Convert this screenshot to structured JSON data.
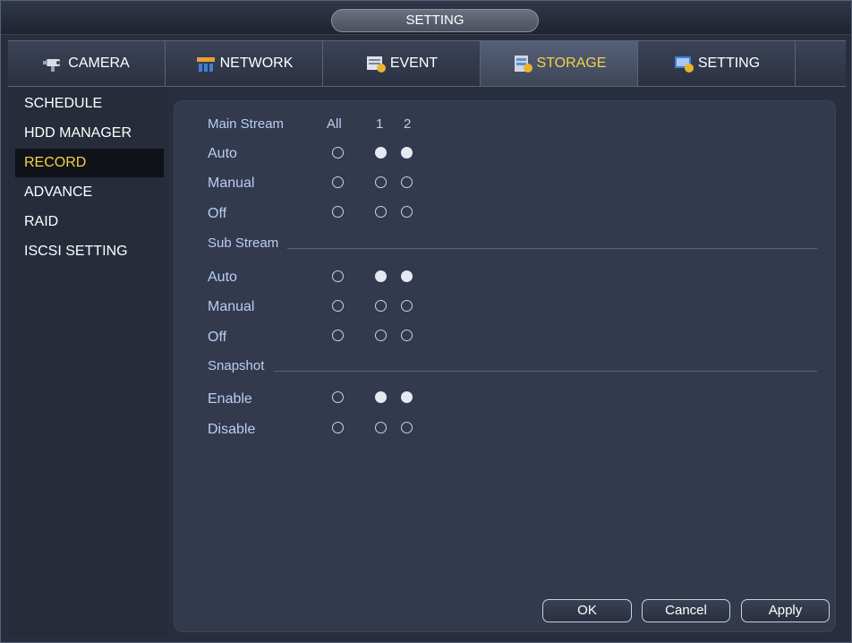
{
  "window": {
    "title": "SETTING"
  },
  "tabs": [
    {
      "label": "CAMERA",
      "icon": "camera-icon"
    },
    {
      "label": "NETWORK",
      "icon": "network-icon"
    },
    {
      "label": "EVENT",
      "icon": "event-icon"
    },
    {
      "label": "STORAGE",
      "icon": "storage-icon",
      "active": true
    },
    {
      "label": "SETTING",
      "icon": "setting-icon"
    }
  ],
  "sidebar": {
    "items": [
      {
        "label": "SCHEDULE"
      },
      {
        "label": "HDD MANAGER"
      },
      {
        "label": "RECORD",
        "active": true
      },
      {
        "label": "ADVANCE"
      },
      {
        "label": "RAID"
      },
      {
        "label": "ISCSI SETTING"
      }
    ]
  },
  "record": {
    "main_stream": {
      "label": "Main Stream",
      "col_all": "All",
      "col_1": "1",
      "col_2": "2",
      "rows": [
        {
          "label": "Auto",
          "all": false,
          "ch1": true,
          "ch2": true
        },
        {
          "label": "Manual",
          "all": false,
          "ch1": false,
          "ch2": false
        },
        {
          "label": "Off",
          "all": false,
          "ch1": false,
          "ch2": false
        }
      ]
    },
    "sub_stream": {
      "label": "Sub Stream",
      "rows": [
        {
          "label": "Auto",
          "all": false,
          "ch1": true,
          "ch2": true
        },
        {
          "label": "Manual",
          "all": false,
          "ch1": false,
          "ch2": false
        },
        {
          "label": "Off",
          "all": false,
          "ch1": false,
          "ch2": false
        }
      ]
    },
    "snapshot": {
      "label": "Snapshot",
      "rows": [
        {
          "label": "Enable",
          "all": false,
          "ch1": true,
          "ch2": true
        },
        {
          "label": "Disable",
          "all": false,
          "ch1": false,
          "ch2": false
        }
      ]
    }
  },
  "buttons": {
    "ok": "OK",
    "cancel": "Cancel",
    "apply": "Apply"
  },
  "colors": {
    "accent": "#f5d24a",
    "label": "#b9cef2"
  }
}
